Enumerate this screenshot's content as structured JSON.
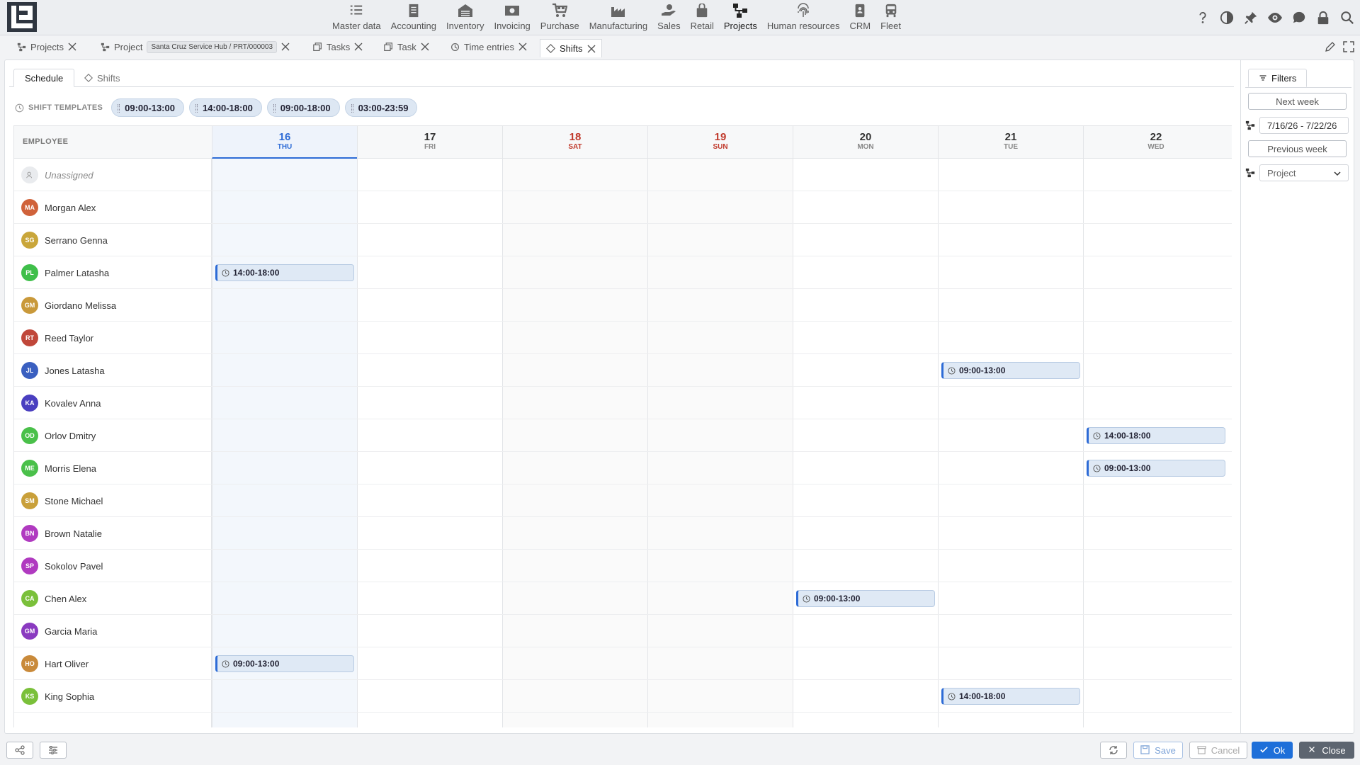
{
  "app": {
    "logo_icon": "app-logo-icon"
  },
  "modules": [
    {
      "label": "Master data",
      "icon": "list-icon"
    },
    {
      "label": "Accounting",
      "icon": "ledger-icon"
    },
    {
      "label": "Inventory",
      "icon": "warehouse-icon"
    },
    {
      "label": "Invoicing",
      "icon": "cash-icon"
    },
    {
      "label": "Purchase",
      "icon": "cart-icon"
    },
    {
      "label": "Manufacturing",
      "icon": "factory-icon"
    },
    {
      "label": "Sales",
      "icon": "hand-coin-icon"
    },
    {
      "label": "Retail",
      "icon": "bag-icon"
    },
    {
      "label": "Projects",
      "icon": "project-tree-icon",
      "active": true
    },
    {
      "label": "Human resources",
      "icon": "fingerprint-icon"
    },
    {
      "label": "CRM",
      "icon": "contact-card-icon"
    },
    {
      "label": "Fleet",
      "icon": "bus-icon"
    }
  ],
  "header_icons": [
    "help-icon",
    "contrast-icon",
    "pin-icon",
    "eye-icon",
    "chat-icon",
    "lock-icon",
    "search-icon"
  ],
  "tabs": [
    {
      "label": "Projects"
    },
    {
      "label": "Project",
      "chip": "Santa Cruz Service Hub / PRT/000003"
    },
    {
      "label": "Tasks"
    },
    {
      "label": "Task"
    },
    {
      "label": "Time entries"
    },
    {
      "label": "Shifts",
      "active": true
    }
  ],
  "inner_tabs": {
    "schedule": "Schedule",
    "shifts": "Shifts"
  },
  "templates": {
    "label": "SHIFT TEMPLATES",
    "items": [
      "09:00-13:00",
      "14:00-18:00",
      "09:00-18:00",
      "03:00-23:59"
    ]
  },
  "schedule": {
    "employee_header": "EMPLOYEE",
    "days": [
      {
        "num": "16",
        "dow": "THU",
        "today": true
      },
      {
        "num": "17",
        "dow": "FRI"
      },
      {
        "num": "18",
        "dow": "SAT",
        "weekend": true
      },
      {
        "num": "19",
        "dow": "SUN",
        "weekend": true
      },
      {
        "num": "20",
        "dow": "MON"
      },
      {
        "num": "21",
        "dow": "TUE"
      },
      {
        "num": "22",
        "dow": "WED"
      }
    ],
    "employees": [
      {
        "name": "Unassigned",
        "initials": "",
        "color": "#e9ebee",
        "unassigned": true
      },
      {
        "name": "Morgan Alex",
        "initials": "MA",
        "color": "#d0623a"
      },
      {
        "name": "Serrano Genna",
        "initials": "SG",
        "color": "#c9a63a"
      },
      {
        "name": "Palmer Latasha",
        "initials": "PL",
        "color": "#3fbf4a"
      },
      {
        "name": "Giordano Melissa",
        "initials": "GM",
        "color": "#c9993a"
      },
      {
        "name": "Reed Taylor",
        "initials": "RT",
        "color": "#c0473a"
      },
      {
        "name": "Jones Latasha",
        "initials": "JL",
        "color": "#3a5fc0"
      },
      {
        "name": "Kovalev Anna",
        "initials": "KA",
        "color": "#4a3fc0"
      },
      {
        "name": "Orlov Dmitry",
        "initials": "OD",
        "color": "#4ac04a"
      },
      {
        "name": "Morris Elena",
        "initials": "ME",
        "color": "#4ac04a"
      },
      {
        "name": "Stone Michael",
        "initials": "SM",
        "color": "#c9a03a"
      },
      {
        "name": "Brown Natalie",
        "initials": "BN",
        "color": "#b03ac0"
      },
      {
        "name": "Sokolov Pavel",
        "initials": "SP",
        "color": "#b03ac0"
      },
      {
        "name": "Chen Alex",
        "initials": "CA",
        "color": "#7ac03a"
      },
      {
        "name": "Garcia Maria",
        "initials": "GM",
        "color": "#8a3ac0"
      },
      {
        "name": "Hart Oliver",
        "initials": "HO",
        "color": "#c98a3a"
      },
      {
        "name": "King Sophia",
        "initials": "KS",
        "color": "#7ac03a"
      }
    ],
    "shifts": [
      {
        "row": 3,
        "day": 0,
        "label": "14:00-18:00"
      },
      {
        "row": 6,
        "day": 5,
        "label": "09:00-13:00"
      },
      {
        "row": 8,
        "day": 6,
        "label": "14:00-18:00"
      },
      {
        "row": 9,
        "day": 6,
        "label": "09:00-13:00"
      },
      {
        "row": 13,
        "day": 4,
        "label": "09:00-13:00"
      },
      {
        "row": 15,
        "day": 0,
        "label": "09:00-13:00"
      },
      {
        "row": 16,
        "day": 5,
        "label": "14:00-18:00"
      }
    ]
  },
  "filters": {
    "tab": "Filters",
    "next_week": "Next week",
    "date_range": "7/16/26 - 7/22/26",
    "previous_week": "Previous week",
    "project_placeholder": "Project"
  },
  "footer": {
    "save": "Save",
    "cancel": "Cancel",
    "ok": "Ok",
    "close": "Close"
  }
}
